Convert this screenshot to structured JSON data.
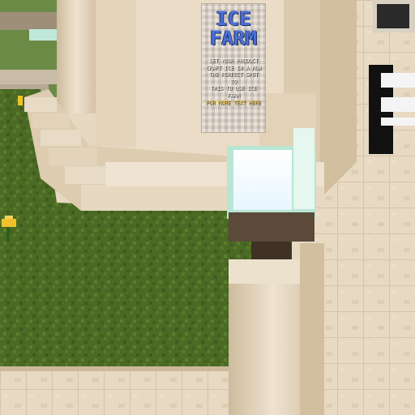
{
  "sign": {
    "title_line1": "ICE",
    "title_line2": "FARM",
    "body_lines": [
      "SET YOUR PRODUCT",
      "CRAFT ICE IN A ROW",
      "THE PERFECT SPOT TO",
      "THIS TO USE ICE FARM",
      "FOR MORE TEXT HERE"
    ],
    "colors": {
      "title": "#4a6fd6",
      "title_outline": "#1f2f66",
      "body": "#f2f0e6",
      "highlight": "#f0c23a"
    }
  },
  "palette": {
    "sandstone_light": "#e9dcc6",
    "sandstone_mid": "#d8c7ab",
    "sandstone_dark": "#b9a686",
    "grass_dark": "#3f5a1e",
    "grass_mid": "#4f6e26",
    "lamp_glow": "#f4fbff",
    "lamp_rim": "#9be3c3",
    "dark_oak": "#5b4a3a",
    "flower_yellow": "#f0c22a"
  }
}
